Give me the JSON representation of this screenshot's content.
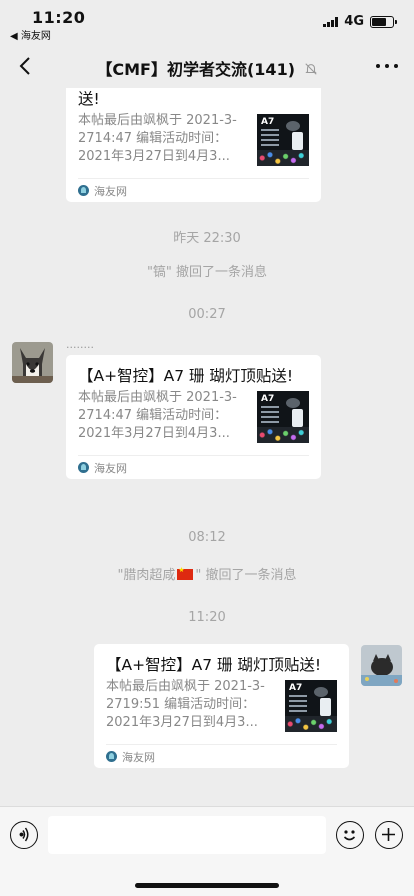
{
  "status_bar": {
    "time": "11:20",
    "back_app": "◀ 海友网",
    "network": "4G",
    "battery_level": 0.7
  },
  "nav": {
    "title": "【CMF】初学者交流(141)"
  },
  "messages": {
    "card1": {
      "title_tail": "送!",
      "desc": "本帖最后由飒枫于 2021-3-2714:47 编辑活动时间：2021年3月27日到4月3...",
      "thumb_label": "A7",
      "source": "海友网"
    },
    "time1": "昨天 22:30",
    "recall1": "\"镐\" 撤回了一条消息",
    "time2": "00:27",
    "nick2": "........",
    "card2": {
      "title": "【A+智控】A7 珊 瑚灯顶贴送!",
      "desc": "本帖最后由飒枫于 2021-3-2714:47 编辑活动时间：2021年3月27日到4月3...",
      "thumb_label": "A7",
      "source": "海友网"
    },
    "time3": "08:12",
    "recall2_a": "\"腊肉超咸",
    "recall2_b": "\" 撤回了一条消息",
    "time4": "11:20",
    "card3": {
      "title": "【A+智控】A7 珊 瑚灯顶贴送!",
      "desc": "本帖最后由飒枫于 2021-3-2719:51 编辑活动时间：2021年3月27日到4月3...",
      "thumb_label": "A7",
      "source": "海友网"
    }
  }
}
